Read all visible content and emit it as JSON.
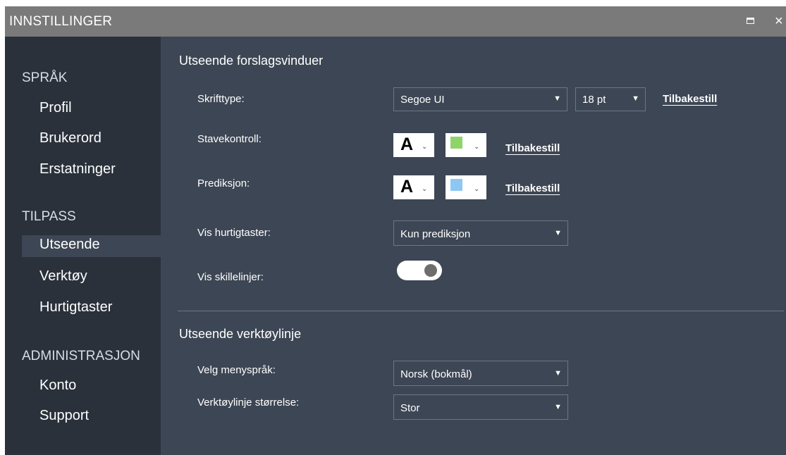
{
  "window": {
    "title": "INNSTILLINGER",
    "maximize_icon": "maximize-icon",
    "close_icon": "close-icon",
    "close_glyph": "×"
  },
  "sidebar": {
    "sections": [
      {
        "label": "SPRÅK",
        "items": [
          "Profil",
          "Brukerord",
          "Erstatninger"
        ]
      },
      {
        "label": "TILPASS",
        "items": [
          "Utseende",
          "Verktøy",
          "Hurtigtaster"
        ]
      },
      {
        "label": "ADMINISTRASJON",
        "items": [
          "Konto",
          "Support"
        ]
      }
    ],
    "active_item": "Utseende"
  },
  "suggestions_section": {
    "heading": "Utseende forslagsvinduer",
    "font": {
      "label": "Skrifttype:",
      "font_value": "Segoe UI",
      "size_value": "18 pt",
      "reset_label": "Tilbakestill"
    },
    "spellcheck": {
      "label": "Stavekontroll:",
      "letter": "A",
      "swatch_color": "#8fd46b",
      "reset_label": "Tilbakestill"
    },
    "prediction": {
      "label": "Prediksjon:",
      "letter": "A",
      "swatch_color": "#8ec8f2",
      "reset_label": "Tilbakestill"
    },
    "shortcuts": {
      "label": "Vis hurtigtaster:",
      "value": "Kun prediksjon"
    },
    "dividers": {
      "label": "Vis skillelinjer:",
      "enabled": true
    }
  },
  "toolbar_section": {
    "heading": "Utseende verktøylinje",
    "menu_language": {
      "label": "Velg menyspråk:",
      "value": "Norsk (bokmål)"
    },
    "toolbar_size": {
      "label": "Verktøylinje størrelse:",
      "value": "Stor"
    }
  },
  "icons": {
    "dropdown_arrow": "▼",
    "color_caret": "⌄"
  }
}
